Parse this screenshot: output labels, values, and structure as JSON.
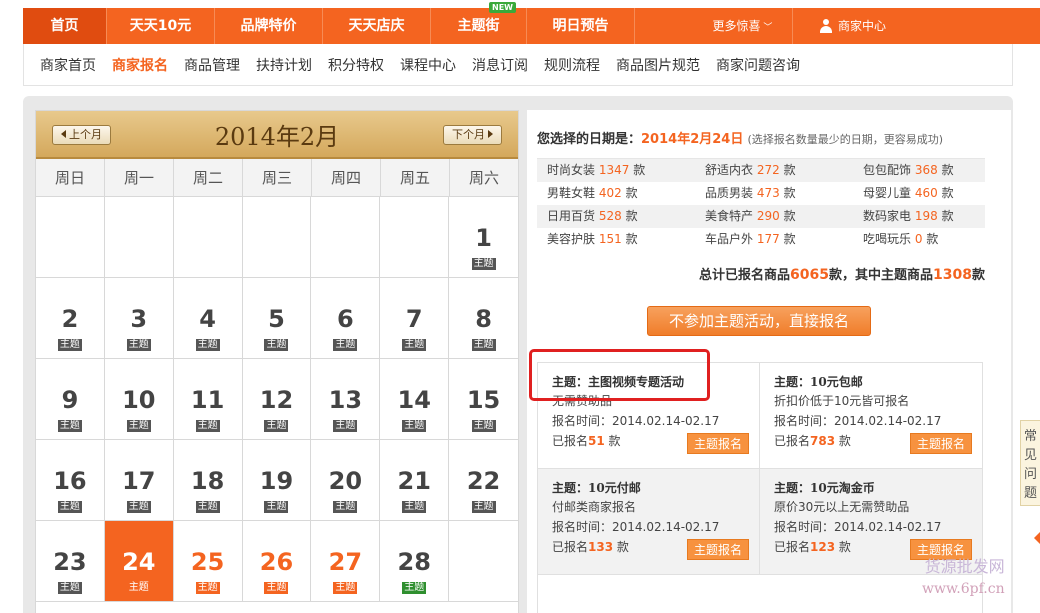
{
  "nav": {
    "items": [
      {
        "label": "首页",
        "width": 84
      },
      {
        "label": "天天10元",
        "width": 108
      },
      {
        "label": "品牌特价",
        "width": 108
      },
      {
        "label": "天天店庆",
        "width": 108
      },
      {
        "label": "主题街",
        "width": 96
      },
      {
        "label": "明日预告",
        "width": 108
      }
    ],
    "new_badge": "NEW",
    "more": "更多惊喜",
    "merchant": "商家中心"
  },
  "subnav": {
    "items": [
      "商家首页",
      "商家报名",
      "商品管理",
      "扶持计划",
      "积分特权",
      "课程中心",
      "消息订阅",
      "规则流程",
      "商品图片规范",
      "商家问题咨询"
    ]
  },
  "calendar": {
    "title": "2014年2月",
    "prev": "上个月",
    "next": "下个月",
    "weekdays": [
      "周日",
      "周一",
      "周二",
      "周三",
      "周四",
      "周五",
      "周六"
    ],
    "tag": "主题",
    "weeks": [
      [
        null,
        null,
        null,
        null,
        null,
        null,
        {
          "d": "1"
        }
      ],
      [
        {
          "d": "2"
        },
        {
          "d": "3"
        },
        {
          "d": "4"
        },
        {
          "d": "5"
        },
        {
          "d": "6"
        },
        {
          "d": "7"
        },
        {
          "d": "8"
        }
      ],
      [
        {
          "d": "9"
        },
        {
          "d": "10"
        },
        {
          "d": "11"
        },
        {
          "d": "12"
        },
        {
          "d": "13"
        },
        {
          "d": "14"
        },
        {
          "d": "15"
        }
      ],
      [
        {
          "d": "16"
        },
        {
          "d": "17"
        },
        {
          "d": "18"
        },
        {
          "d": "19"
        },
        {
          "d": "20"
        },
        {
          "d": "21"
        },
        {
          "d": "22"
        }
      ],
      [
        {
          "d": "23"
        },
        {
          "d": "24",
          "s": "selected"
        },
        {
          "d": "25",
          "s": "orange"
        },
        {
          "d": "26",
          "s": "orange"
        },
        {
          "d": "27",
          "s": "orange"
        },
        {
          "d": "28",
          "s": "green"
        },
        null
      ]
    ]
  },
  "selection": {
    "label": "您选择的日期是：",
    "date": "2014年2月24日",
    "hint": "(选择报名数量最少的日期，更容易成功)"
  },
  "categories": [
    [
      {
        "name": "时尚女装",
        "n": "1347"
      },
      {
        "name": "舒适内衣",
        "n": "272"
      },
      {
        "name": "包包配饰",
        "n": "368"
      }
    ],
    [
      {
        "name": "男鞋女鞋",
        "n": "402"
      },
      {
        "name": "品质男装",
        "n": "473"
      },
      {
        "name": "母婴儿童",
        "n": "460"
      }
    ],
    [
      {
        "name": "日用百货",
        "n": "528"
      },
      {
        "name": "美食特产",
        "n": "290"
      },
      {
        "name": "数码家电",
        "n": "198"
      }
    ],
    [
      {
        "name": "美容护肤",
        "n": "151"
      },
      {
        "name": "车品户外",
        "n": "177"
      },
      {
        "name": "吃喝玩乐",
        "n": "0"
      }
    ]
  ],
  "unit": "款",
  "totals": {
    "pre": "总计已报名商品",
    "total": "6065",
    "mid": "款，其中主题商品",
    "theme": "1308",
    "post": "款"
  },
  "direct_button": "不参加主题活动，直接报名",
  "themes": [
    {
      "title": "主题：主图视频专题活动",
      "desc": "无需赞助品",
      "time": "报名时间：2014.02.14-02.17",
      "count_pre": "已报名",
      "count": "51",
      "count_post": "款",
      "btn": "主题报名"
    },
    {
      "title": "主题：10元包邮",
      "desc": "折扣价低于10元皆可报名",
      "time": "报名时间：2014.02.14-02.17",
      "count_pre": "已报名",
      "count": "783",
      "count_post": "款",
      "btn": "主题报名"
    },
    {
      "title": "主题：10元付邮",
      "desc": "付邮类商家报名",
      "time": "报名时间：2014.02.14-02.17",
      "count_pre": "已报名",
      "count": "133",
      "count_post": "款",
      "btn": "主题报名"
    },
    {
      "title": "主题：10元淘金币",
      "desc": "原价30元以上无需赞助品",
      "time": "报名时间：2014.02.14-02.17",
      "count_pre": "已报名",
      "count": "123",
      "count_post": "款",
      "btn": "主题报名"
    }
  ],
  "side_tab": [
    "常",
    "见",
    "问",
    "题"
  ],
  "watermark": {
    "line1": "货源批发网",
    "line2": "www.6pf.cn"
  }
}
